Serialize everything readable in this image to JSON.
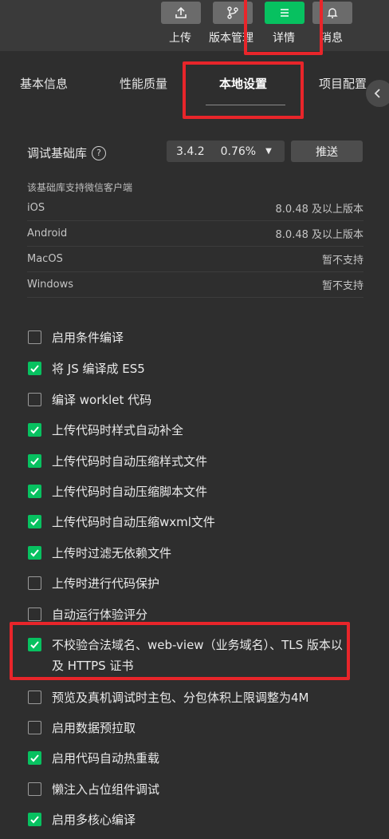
{
  "toolbar": {
    "buttons": [
      {
        "label": "上传",
        "icon": "upload-icon",
        "active": false
      },
      {
        "label": "版本管理",
        "icon": "branch-icon",
        "active": false
      },
      {
        "label": "详情",
        "icon": "menu-icon",
        "active": true
      },
      {
        "label": "消息",
        "icon": "bell-icon",
        "active": false
      }
    ]
  },
  "tabs": [
    {
      "label": "基本信息",
      "active": false
    },
    {
      "label": "性能质量",
      "active": false
    },
    {
      "label": "本地设置",
      "active": true
    },
    {
      "label": "项目配置",
      "active": false
    }
  ],
  "baselib": {
    "label": "调试基础库",
    "help": "?",
    "version": "3.4.2",
    "percent": "0.76%",
    "push_label": "推送"
  },
  "support": {
    "title": "该基础库支持微信客户端",
    "rows": [
      {
        "platform": "iOS",
        "value": "8.0.48 及以上版本"
      },
      {
        "platform": "Android",
        "value": "8.0.48 及以上版本"
      },
      {
        "platform": "MacOS",
        "value": "暂不支持"
      },
      {
        "platform": "Windows",
        "value": "暂不支持"
      }
    ]
  },
  "options": [
    {
      "label": "启用条件编译",
      "checked": false
    },
    {
      "label": "将 JS 编译成 ES5",
      "checked": true
    },
    {
      "label": "编译 worklet 代码",
      "checked": false
    },
    {
      "label": "上传代码时样式自动补全",
      "checked": true
    },
    {
      "label": "上传代码时自动压缩样式文件",
      "checked": true
    },
    {
      "label": "上传代码时自动压缩脚本文件",
      "checked": true
    },
    {
      "label": "上传代码时自动压缩wxml文件",
      "checked": true
    },
    {
      "label": "上传时过滤无依赖文件",
      "checked": true
    },
    {
      "label": "上传时进行代码保护",
      "checked": false
    },
    {
      "label": "自动运行体验评分",
      "checked": false
    },
    {
      "label": "不校验合法域名、web-view（业务域名）、TLS 版本以及 HTTPS 证书",
      "checked": true
    },
    {
      "label": "预览及真机调试时主包、分包体积上限调整为4M",
      "checked": false
    },
    {
      "label": "启用数据预拉取",
      "checked": false
    },
    {
      "label": "启用代码自动热重载",
      "checked": true
    },
    {
      "label": "懒注入占位组件调试",
      "checked": false
    },
    {
      "label": "启用多核心编译",
      "checked": true
    }
  ],
  "colors": {
    "accent": "#07c160",
    "highlight": "#e8252a",
    "background": "#2e2e2e"
  }
}
